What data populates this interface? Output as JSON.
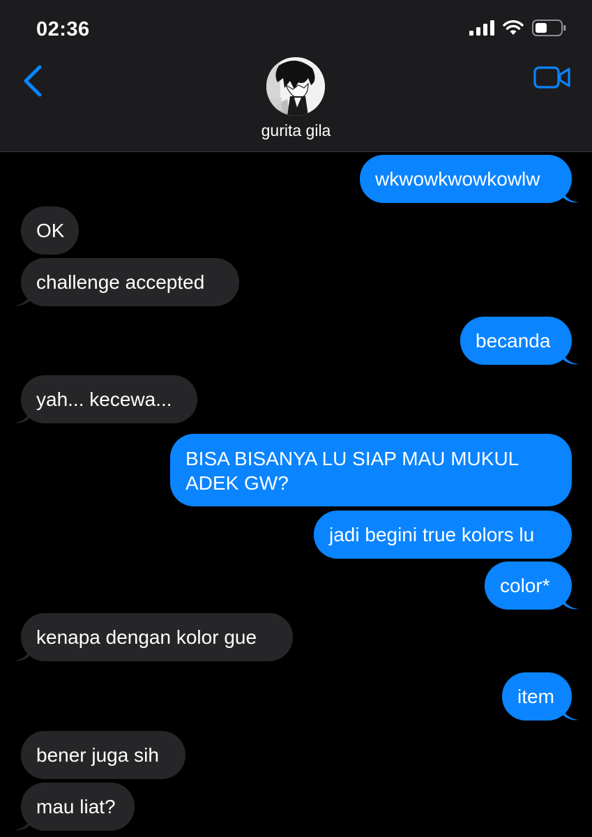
{
  "status_bar": {
    "time": "02:36"
  },
  "header": {
    "contact_name": "gurita gila",
    "back_icon": "chevron-left-icon",
    "video_icon": "video-camera-icon"
  },
  "colors": {
    "outgoing": "#0a84ff",
    "incoming": "#262628",
    "header_bg": "#1c1c1e",
    "accent": "#0a84ff"
  },
  "messages": [
    {
      "dir": "out",
      "text": "wkwowkwowkowlw"
    },
    {
      "dir": "in",
      "text": "OK"
    },
    {
      "dir": "in",
      "text": "challenge accepted"
    },
    {
      "dir": "out",
      "text": "becanda"
    },
    {
      "dir": "in",
      "text": "yah... kecewa..."
    },
    {
      "dir": "out",
      "text": "BISA BISANYA LU SIAP MAU MUKUL ADEK GW?"
    },
    {
      "dir": "out",
      "text": "jadi begini true kolors lu"
    },
    {
      "dir": "out",
      "text": "color*"
    },
    {
      "dir": "in",
      "text": "kenapa dengan kolor gue"
    },
    {
      "dir": "out",
      "text": "item"
    },
    {
      "dir": "in",
      "text": "bener juga sih"
    },
    {
      "dir": "in",
      "text": "mau liat?"
    }
  ]
}
